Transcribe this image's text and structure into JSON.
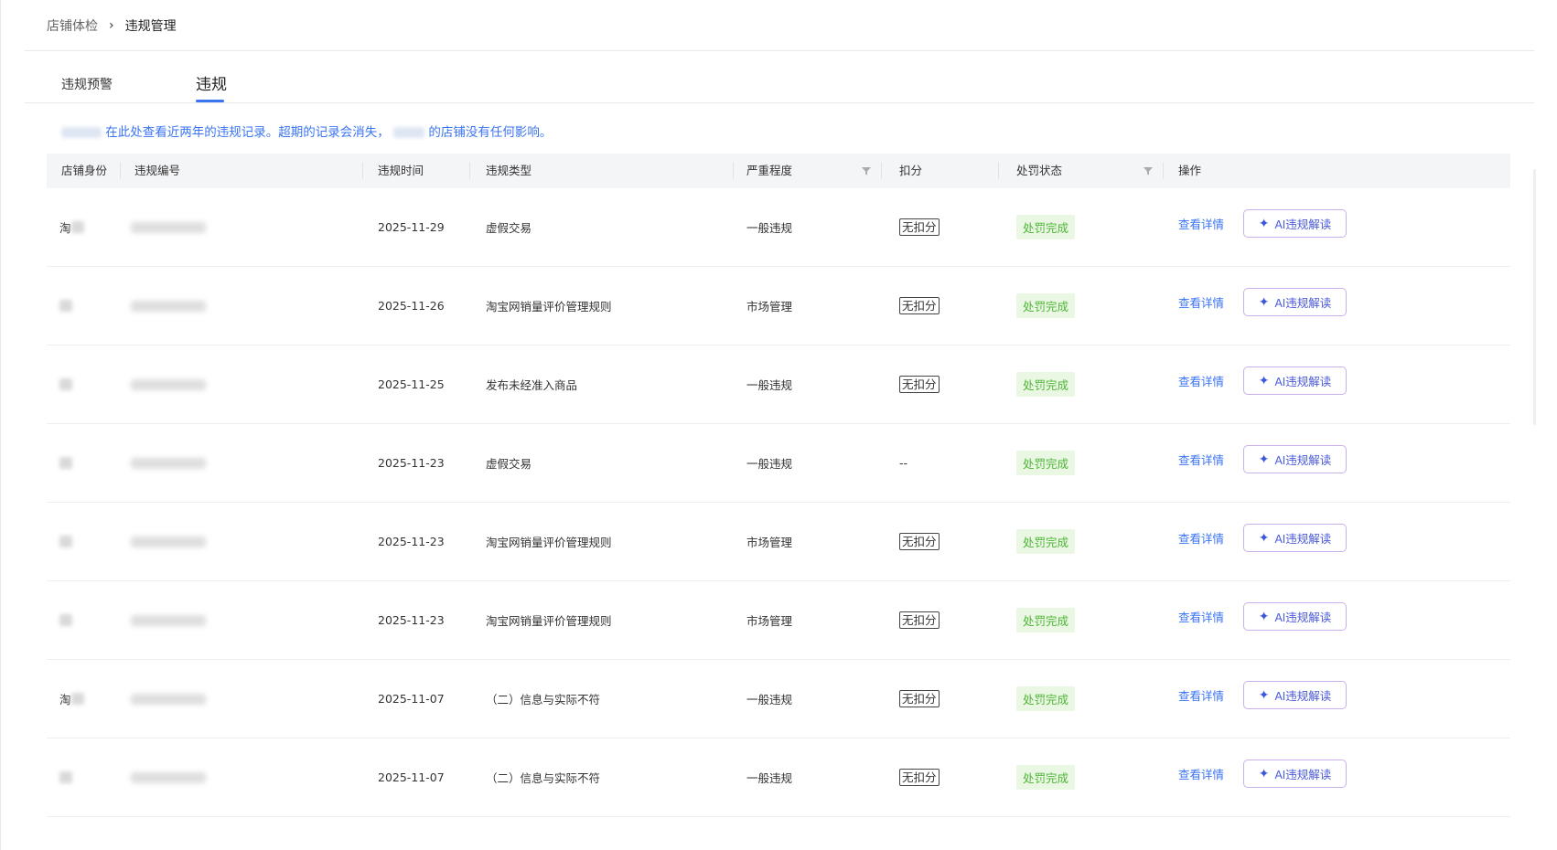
{
  "breadcrumb": {
    "parent": "店铺体检",
    "separator": "›",
    "current": "违规管理"
  },
  "tabs": [
    {
      "label": "违规预警",
      "active": false
    },
    {
      "label": "违规",
      "active": true
    }
  ],
  "notice": {
    "part1": "在此处查看近两年的违规记录。超期的记录会消失，",
    "part2": "的店铺没有任何影响。"
  },
  "table": {
    "columns": [
      "店铺身份",
      "违规编号",
      "违规时间",
      "违规类型",
      "严重程度",
      "扣分",
      "处罚状态",
      "操作"
    ],
    "rows": [
      {
        "shop": "淘",
        "date": "2025-11-29",
        "type": "虚假交易",
        "severity": "一般违规",
        "deduct": "无扣分",
        "deduct_tag": true,
        "status": "处罚完成",
        "action_detail": "查看详情",
        "action_ai": "AI违规解读"
      },
      {
        "shop": "",
        "date": "2025-11-26",
        "type": "淘宝网销量评价管理规则",
        "severity": "市场管理",
        "deduct": "无扣分",
        "deduct_tag": true,
        "status": "处罚完成",
        "action_detail": "查看详情",
        "action_ai": "AI违规解读"
      },
      {
        "shop": "",
        "date": "2025-11-25",
        "type": "发布未经准入商品",
        "severity": "一般违规",
        "deduct": "无扣分",
        "deduct_tag": true,
        "status": "处罚完成",
        "action_detail": "查看详情",
        "action_ai": "AI违规解读"
      },
      {
        "shop": "",
        "date": "2025-11-23",
        "type": "虚假交易",
        "severity": "一般违规",
        "deduct": "--",
        "deduct_tag": false,
        "status": "处罚完成",
        "action_detail": "查看详情",
        "action_ai": "AI违规解读"
      },
      {
        "shop": "",
        "date": "2025-11-23",
        "type": "淘宝网销量评价管理规则",
        "severity": "市场管理",
        "deduct": "无扣分",
        "deduct_tag": true,
        "status": "处罚完成",
        "action_detail": "查看详情",
        "action_ai": "AI违规解读"
      },
      {
        "shop": "",
        "date": "2025-11-23",
        "type": "淘宝网销量评价管理规则",
        "severity": "市场管理",
        "deduct": "无扣分",
        "deduct_tag": true,
        "status": "处罚完成",
        "action_detail": "查看详情",
        "action_ai": "AI违规解读"
      },
      {
        "shop": "淘",
        "date": "2025-11-07",
        "type": "（二）信息与实际不符",
        "severity": "一般违规",
        "deduct": "无扣分",
        "deduct_tag": true,
        "status": "处罚完成",
        "action_detail": "查看详情",
        "action_ai": "AI违规解读"
      },
      {
        "shop": "",
        "date": "2025-11-07",
        "type": "（二）信息与实际不符",
        "severity": "一般违规",
        "deduct": "无扣分",
        "deduct_tag": true,
        "status": "处罚完成",
        "action_detail": "查看详情",
        "action_ai": "AI违规解读"
      }
    ]
  },
  "icons": {
    "filter": "filter-icon",
    "sparkle": "sparkle-icon",
    "chevron": "chevron-right-icon"
  },
  "colors": {
    "accent": "#3b74f2",
    "status_green": "#4fb537",
    "status_bg": "#e9f7e3",
    "ai_border": "#c7b1ea"
  }
}
